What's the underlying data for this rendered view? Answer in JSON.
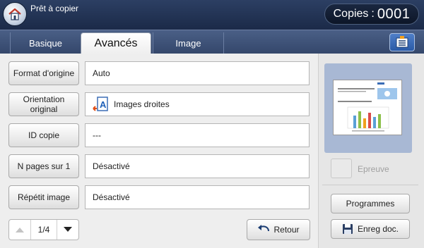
{
  "header": {
    "status": "Prêt à copier",
    "copies_label": "Copies",
    "copies_separator": ":",
    "copies_value": "0001"
  },
  "tabs": [
    {
      "label": "Basique",
      "active": false
    },
    {
      "label": "Avancés",
      "active": true
    },
    {
      "label": "Image",
      "active": false
    }
  ],
  "options": [
    {
      "label": "Format d'origine",
      "value": "Auto"
    },
    {
      "label_line1": "Orientation",
      "label_line2": "original",
      "value": "Images droites",
      "icon": "orientation-portrait-icon"
    },
    {
      "label": "ID copie",
      "value": "---"
    },
    {
      "label": "N pages sur 1",
      "value": "Désactivé"
    },
    {
      "label": "Répétit image",
      "value": "Désactivé"
    }
  ],
  "pager": {
    "current": "1/4"
  },
  "back_label": "Retour",
  "side": {
    "proof_label": "Epreuve",
    "programs_label": "Programmes",
    "save_doc_label": "Enreg doc."
  },
  "colors": {
    "header_bg": "#1f2e4d",
    "tab_bar_bg": "#3e5278",
    "preview_bg": "#a8b8d4",
    "accent_blue": "#2a5aa6"
  }
}
